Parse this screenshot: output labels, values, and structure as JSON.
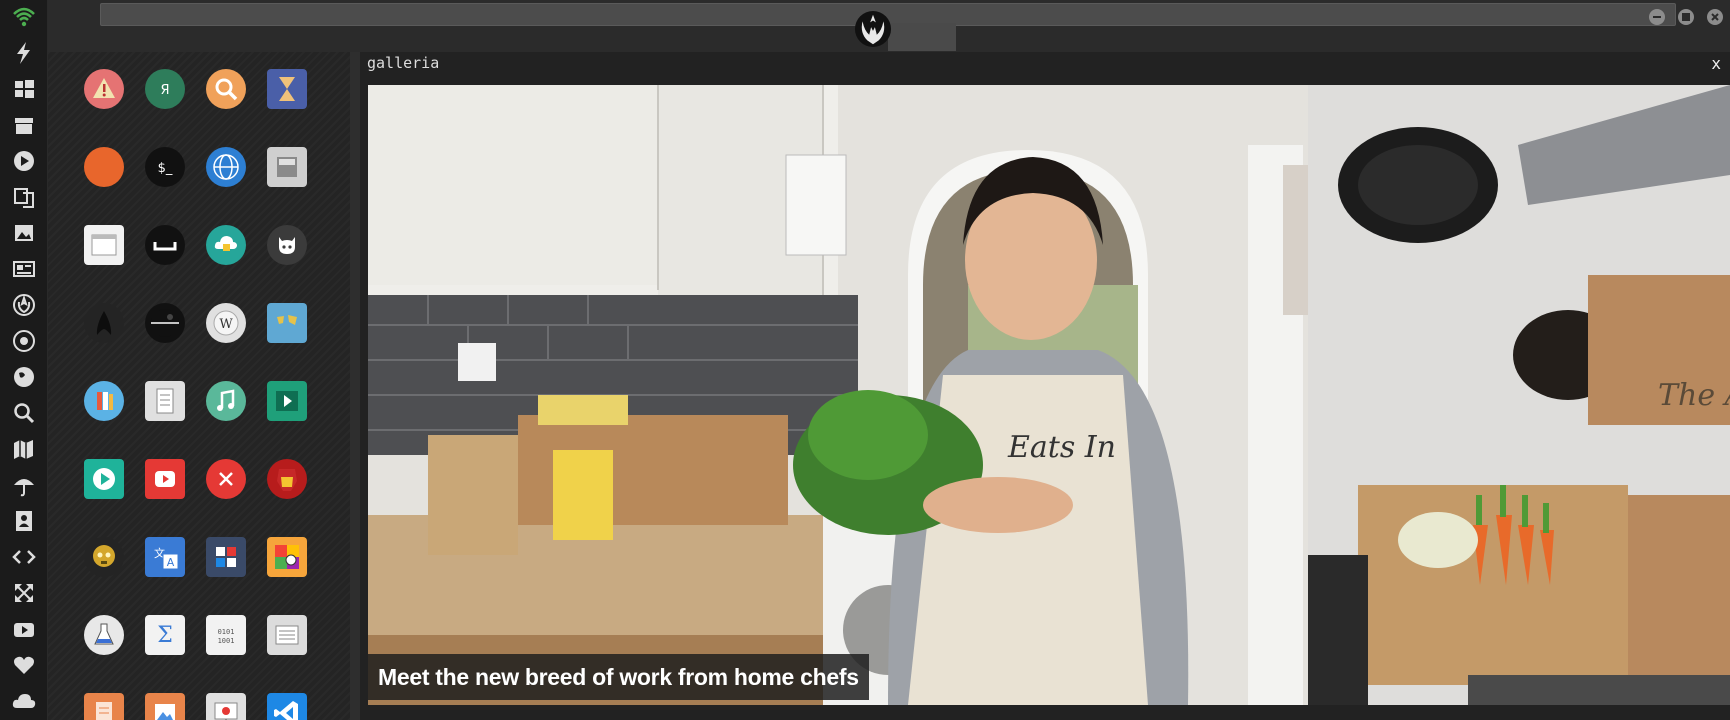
{
  "window": {
    "title": "galleria",
    "close_label": "x"
  },
  "rail": {
    "items": [
      {
        "icon": "wifi-icon"
      },
      {
        "icon": "lightning-icon"
      },
      {
        "icon": "windows-icon"
      },
      {
        "icon": "archive-icon"
      },
      {
        "icon": "play-circle-icon"
      },
      {
        "icon": "translate-icon"
      },
      {
        "icon": "image-icon"
      },
      {
        "icon": "newspaper-icon"
      },
      {
        "icon": "rebel-alliance-icon"
      },
      {
        "icon": "empire-icon"
      },
      {
        "icon": "globe-icon"
      },
      {
        "icon": "search-icon"
      },
      {
        "icon": "map-icon"
      },
      {
        "icon": "umbrella-icon"
      },
      {
        "icon": "contact-card-icon"
      },
      {
        "icon": "code-icon"
      },
      {
        "icon": "expand-icon"
      },
      {
        "icon": "youtube-icon"
      },
      {
        "icon": "heart-icon"
      },
      {
        "icon": "cloud-icon"
      }
    ]
  },
  "apps": [
    {
      "name": "warning-app-icon",
      "color": "#e57373"
    },
    {
      "name": "yandex-app-icon",
      "color": "#2e7d5b",
      "glyph": "Я"
    },
    {
      "name": "search-app-icon",
      "color": "#f0a15a"
    },
    {
      "name": "hourglass-app-icon",
      "color": "#4a5fa8"
    },
    {
      "name": "terminal-arrow-app-icon",
      "color": "#e8662c"
    },
    {
      "name": "terminal-app-icon",
      "color": "#111111",
      "glyph": "$_"
    },
    {
      "name": "globe-app-icon",
      "color": "#2d7fd3"
    },
    {
      "name": "drive-app-icon",
      "color": "#cfcfcf"
    },
    {
      "name": "browser-window-app-icon",
      "color": "#f2f2f2"
    },
    {
      "name": "bracket-app-icon",
      "color": "#111111"
    },
    {
      "name": "cloud-lock-app-icon",
      "color": "#26a69a"
    },
    {
      "name": "github-app-icon",
      "color": "#3b3b3b"
    },
    {
      "name": "starfleet-app-icon",
      "color": "#242424"
    },
    {
      "name": "death-star-app-icon",
      "color": "#111111"
    },
    {
      "name": "wikipedia-app-icon",
      "color": "#e0e0e0"
    },
    {
      "name": "world-map-app-icon",
      "color": "#5fa8d3"
    },
    {
      "name": "library-app-icon",
      "color": "#5bb2e5"
    },
    {
      "name": "notes-app-icon",
      "color": "#e0e0e0"
    },
    {
      "name": "music-app-icon",
      "color": "#5ab89a"
    },
    {
      "name": "video-app-icon",
      "color": "#1fa07a"
    },
    {
      "name": "media-player-app-icon",
      "color": "#1fb39a"
    },
    {
      "name": "youtube-app-icon",
      "color": "#e53935"
    },
    {
      "name": "close-circle-app-icon",
      "color": "#e53935"
    },
    {
      "name": "ironman-app-icon",
      "color": "#b71c1c"
    },
    {
      "name": "c3po-app-icon",
      "color": "#242424"
    },
    {
      "name": "translate-app-icon",
      "color": "#3a7bd5"
    },
    {
      "name": "calculator-app-icon",
      "color": "#3a4a68"
    },
    {
      "name": "color-picker-app-icon",
      "color": "#f6a53b"
    },
    {
      "name": "flask-app-icon",
      "color": "#e8e8e8"
    },
    {
      "name": "sigma-app-icon",
      "color": "#f2f2f2"
    },
    {
      "name": "binary-app-icon",
      "color": "#f2f2f2",
      "glyph": "0101"
    },
    {
      "name": "text-lines-app-icon",
      "color": "#dcdcdc"
    },
    {
      "name": "document-app-icon",
      "color": "#e8844a"
    },
    {
      "name": "picture-app-icon",
      "color": "#e8844a"
    },
    {
      "name": "presentation-app-icon",
      "color": "#e0e0e0"
    },
    {
      "name": "vscode-app-icon",
      "color": "#1e88e5"
    }
  ],
  "gallery": {
    "caption": "Meet the new breed of work from home chefs",
    "apron_text": "Eats In",
    "box_text": "The Apron"
  }
}
